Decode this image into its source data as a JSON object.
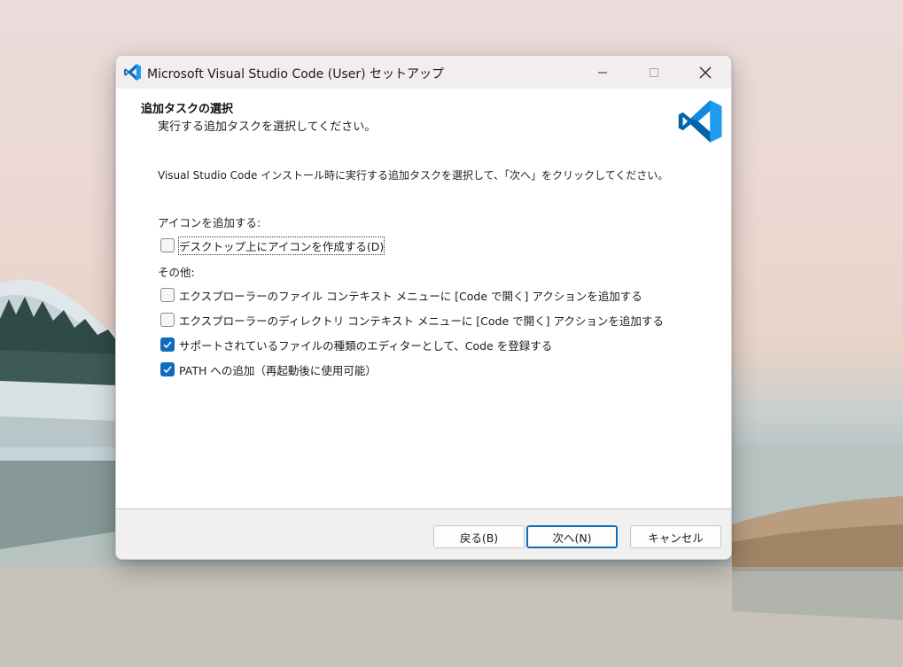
{
  "window": {
    "title": "Microsoft Visual Studio Code (User) セットアップ",
    "icon": "vscode-logo-icon"
  },
  "header": {
    "title": "追加タスクの選択",
    "subtitle": "実行する追加タスクを選択してください。",
    "logo": "vscode-logo-icon"
  },
  "content": {
    "description": "Visual Studio Code インストール時に実行する追加タスクを選択して、「次へ」をクリックしてください。",
    "groups": [
      {
        "label": "アイコンを追加する:",
        "items": [
          {
            "label": "デスクトップ上にアイコンを作成する(D)",
            "checked": false
          }
        ]
      },
      {
        "label": "その他:",
        "items": [
          {
            "label": "エクスプローラーのファイル コンテキスト メニューに [Code で開く] アクションを追加する",
            "checked": false
          },
          {
            "label": "エクスプローラーのディレクトリ コンテキスト メニューに [Code で開く] アクションを追加する",
            "checked": false
          },
          {
            "label": "サポートされているファイルの種類のエディターとして、Code を登録する",
            "checked": true
          },
          {
            "label": "PATH への追加（再起動後に使用可能）",
            "checked": true
          }
        ]
      }
    ]
  },
  "buttons": {
    "back": "戻る(B)",
    "next": "次へ(N)",
    "cancel": "キャンセル"
  },
  "colors": {
    "accent": "#0f6cbd",
    "vscode_blue": "#0065a9",
    "vscode_light": "#1f9cf0"
  }
}
